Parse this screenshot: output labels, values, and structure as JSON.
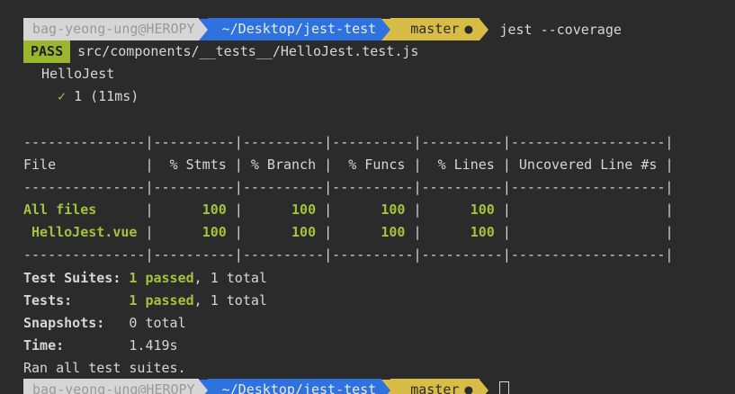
{
  "prompt1": {
    "user": "bag-yeong-ung@HEROPY",
    "dir": "~/Desktop/jest-test",
    "branch_icon": "",
    "branch": "master",
    "dirty_dot": "●",
    "command": "jest --coverage"
  },
  "result": {
    "badge": "PASS",
    "path": "src/components/__tests__/HelloJest.test.js",
    "suite": "HelloJest",
    "check": "✓",
    "test": "1 (11ms)"
  },
  "coverage": {
    "separator": "---------------|----------|----------|----------|----------|-------------------|",
    "header": {
      "file": "File",
      "stmts": "% Stmts",
      "branch": "% Branch",
      "funcs": "% Funcs",
      "lines": "% Lines",
      "uncovered": "Uncovered Line #s"
    },
    "rows": [
      {
        "file": "All files",
        "stmts": "100",
        "branch": "100",
        "funcs": "100",
        "lines": "100",
        "uncovered": ""
      },
      {
        "file": " HelloJest.vue",
        "stmts": "100",
        "branch": "100",
        "funcs": "100",
        "lines": "100",
        "uncovered": ""
      }
    ]
  },
  "summary": {
    "suites_label": "Test Suites:",
    "suites_passed": "1 passed",
    "suites_total": ", 1 total",
    "tests_label": "Tests:",
    "tests_passed": "1 passed",
    "tests_total": ", 1 total",
    "snapshots_label": "Snapshots:",
    "snapshots_value": "0 total",
    "time_label": "Time:",
    "time_value": "1.419s",
    "ran": "Ran all test suites."
  },
  "prompt2": {
    "user": "bag-yeong-ung@HEROPY",
    "dir": "~/Desktop/jest-test",
    "branch_icon": "",
    "branch": "master",
    "dirty_dot": "●"
  },
  "colors": {
    "background": "#2b2b2b",
    "user_segment": "#d6d6d6",
    "dir_segment": "#2e72e0",
    "git_segment": "#d7bd46",
    "pass_badge": "#9ab62e",
    "green_text": "#a7c13b"
  }
}
